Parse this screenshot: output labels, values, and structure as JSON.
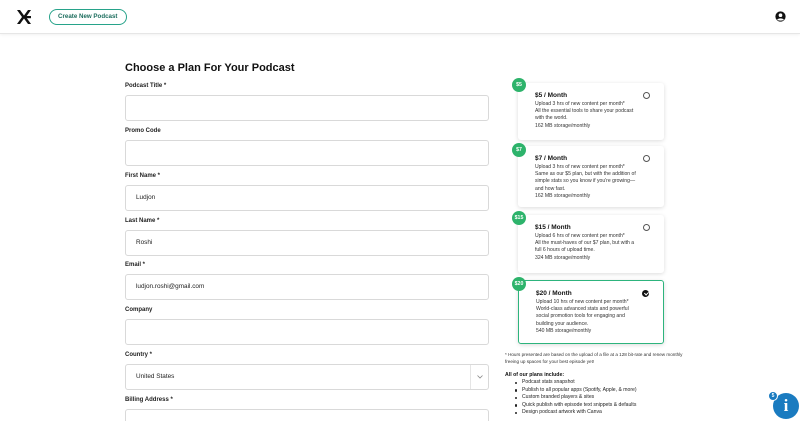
{
  "header": {
    "create_button_label": "Create New Podcast",
    "logo_icon": "brand-logo-icon",
    "user_icon": "user-account-icon"
  },
  "page_title": "Choose a Plan For Your Podcast",
  "form": {
    "podcast_title": {
      "label": "Podcast Title *",
      "value": ""
    },
    "promo_code": {
      "label": "Promo Code",
      "value": ""
    },
    "first_name": {
      "label": "First Name *",
      "value": "Ludjon"
    },
    "last_name": {
      "label": "Last Name *",
      "value": "Roshi"
    },
    "email": {
      "label": "Email *",
      "value": "ludjon.roshi@gmail.com"
    },
    "company": {
      "label": "Company",
      "value": ""
    },
    "country": {
      "label": "Country *",
      "value": "United States"
    },
    "billing_address": {
      "label": "Billing Address *",
      "value": ""
    }
  },
  "plans": [
    {
      "badge": "$5",
      "name": "$5 / Month",
      "upload": "Upload 3 hrs of new content per month*",
      "desc": "All the essential tools to share your podcast with the world.",
      "storage": "162 MB storage/monthly",
      "selected": false
    },
    {
      "badge": "$7",
      "name": "$7 / Month",
      "upload": "Upload 3 hrs of new content per month*",
      "desc": "Same as our $5 plan, but with the addition of simple stats so you know if you're growing—and how fast.",
      "storage": "162 MB storage/monthly",
      "selected": false
    },
    {
      "badge": "$15",
      "name": "$15 / Month",
      "upload": "Upload 6 hrs of new content per month*",
      "desc": "All the must-haves of our $7 plan, but with a full 6 hours of upload time.",
      "storage": "324 MB storage/monthly",
      "selected": false
    },
    {
      "badge": "$20",
      "name": "$20 / Month",
      "upload": "Upload 10 hrs of new content per month*",
      "desc": "World-class advanced stats and powerful social promotion tools for engaging and building your audience.",
      "storage": "540 MB storage/monthly",
      "selected": true
    }
  ],
  "footnote": "* Hours presented are based on the upload of a file at a 128 bit-rate and renew monthly freeing up spaces for your best episode yet!",
  "features_title": "All of our plans include:",
  "features": [
    "Podcast stats snapshot",
    "Publish to all popular apps (Spotify, Apple, & more)",
    "Custom branded players & sites",
    "Quick publish with episode text snippets & defaults",
    "Design podcast artwork with Canva"
  ],
  "help": {
    "count": "5",
    "icon": "info-icon",
    "glyph": "i"
  },
  "colors": {
    "accent": "#2db36b",
    "button_border": "#27a38a",
    "help": "#1a7bc0"
  }
}
